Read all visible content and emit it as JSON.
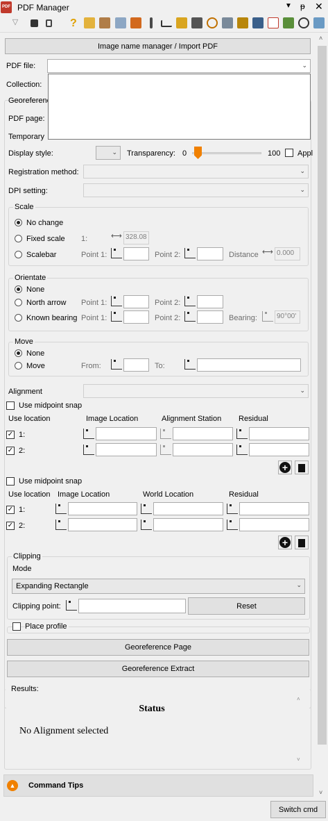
{
  "window": {
    "title": "PDF Manager"
  },
  "buttons": {
    "import": "Image name manager / Import PDF",
    "georef_page": "Georeference Page",
    "georef_extract": "Georeference Extract",
    "reset": "Reset",
    "switch_cmd": "Switch cmd"
  },
  "form": {
    "pdf_file_label": "PDF file:",
    "collection_label": "Collection:",
    "georef_label": "Georeferenc",
    "pdf_page_label": "PDF page:",
    "temporary_label": "Temporary",
    "display_style_label": "Display style:",
    "transparency_label": "Transparency:",
    "transparency_min": "0",
    "transparency_max": "100",
    "transparency_value": 0.03,
    "apply_label": "Appl",
    "registration_label": "Registration method:",
    "dpi_label": "DPI setting:"
  },
  "scale": {
    "title": "Scale",
    "no_change": "No change",
    "fixed_scale": "Fixed scale",
    "fixed_prefix": "1:",
    "fixed_value": "328.08",
    "scalebar": "Scalebar",
    "point1": "Point 1:",
    "point2": "Point 2:",
    "distance": "Distance",
    "distance_value": "0.000"
  },
  "orientate": {
    "title": "Orientate",
    "none": "None",
    "north_arrow": "North arrow",
    "known_bearing": "Known bearing",
    "point1": "Point 1:",
    "point2": "Point 2:",
    "bearing": "Bearing:",
    "bearing_value": "90°00'"
  },
  "move": {
    "title": "Move",
    "none": "None",
    "move": "Move",
    "from": "From:",
    "to": "To:"
  },
  "alignment": {
    "label": "Alignment",
    "use_midpoint": "Use midpoint snap",
    "cols": [
      "Use location",
      "Image Location",
      "Alignment Station",
      "Residual"
    ],
    "rows": [
      "1:",
      "2:"
    ]
  },
  "world": {
    "use_midpoint": "Use midpoint snap",
    "cols": [
      "Use location",
      "Image Location",
      "World Location",
      "Residual"
    ],
    "rows": [
      "1:",
      "2:"
    ]
  },
  "clipping": {
    "title": "Clipping",
    "mode_label": "Mode",
    "mode_value": "Expanding Rectangle",
    "point_label": "Clipping point:"
  },
  "place_profile": "Place profile",
  "results": {
    "label": "Results:",
    "heading": "Status",
    "message": "No Alignment selected"
  },
  "tips": {
    "label": "Command Tips"
  }
}
